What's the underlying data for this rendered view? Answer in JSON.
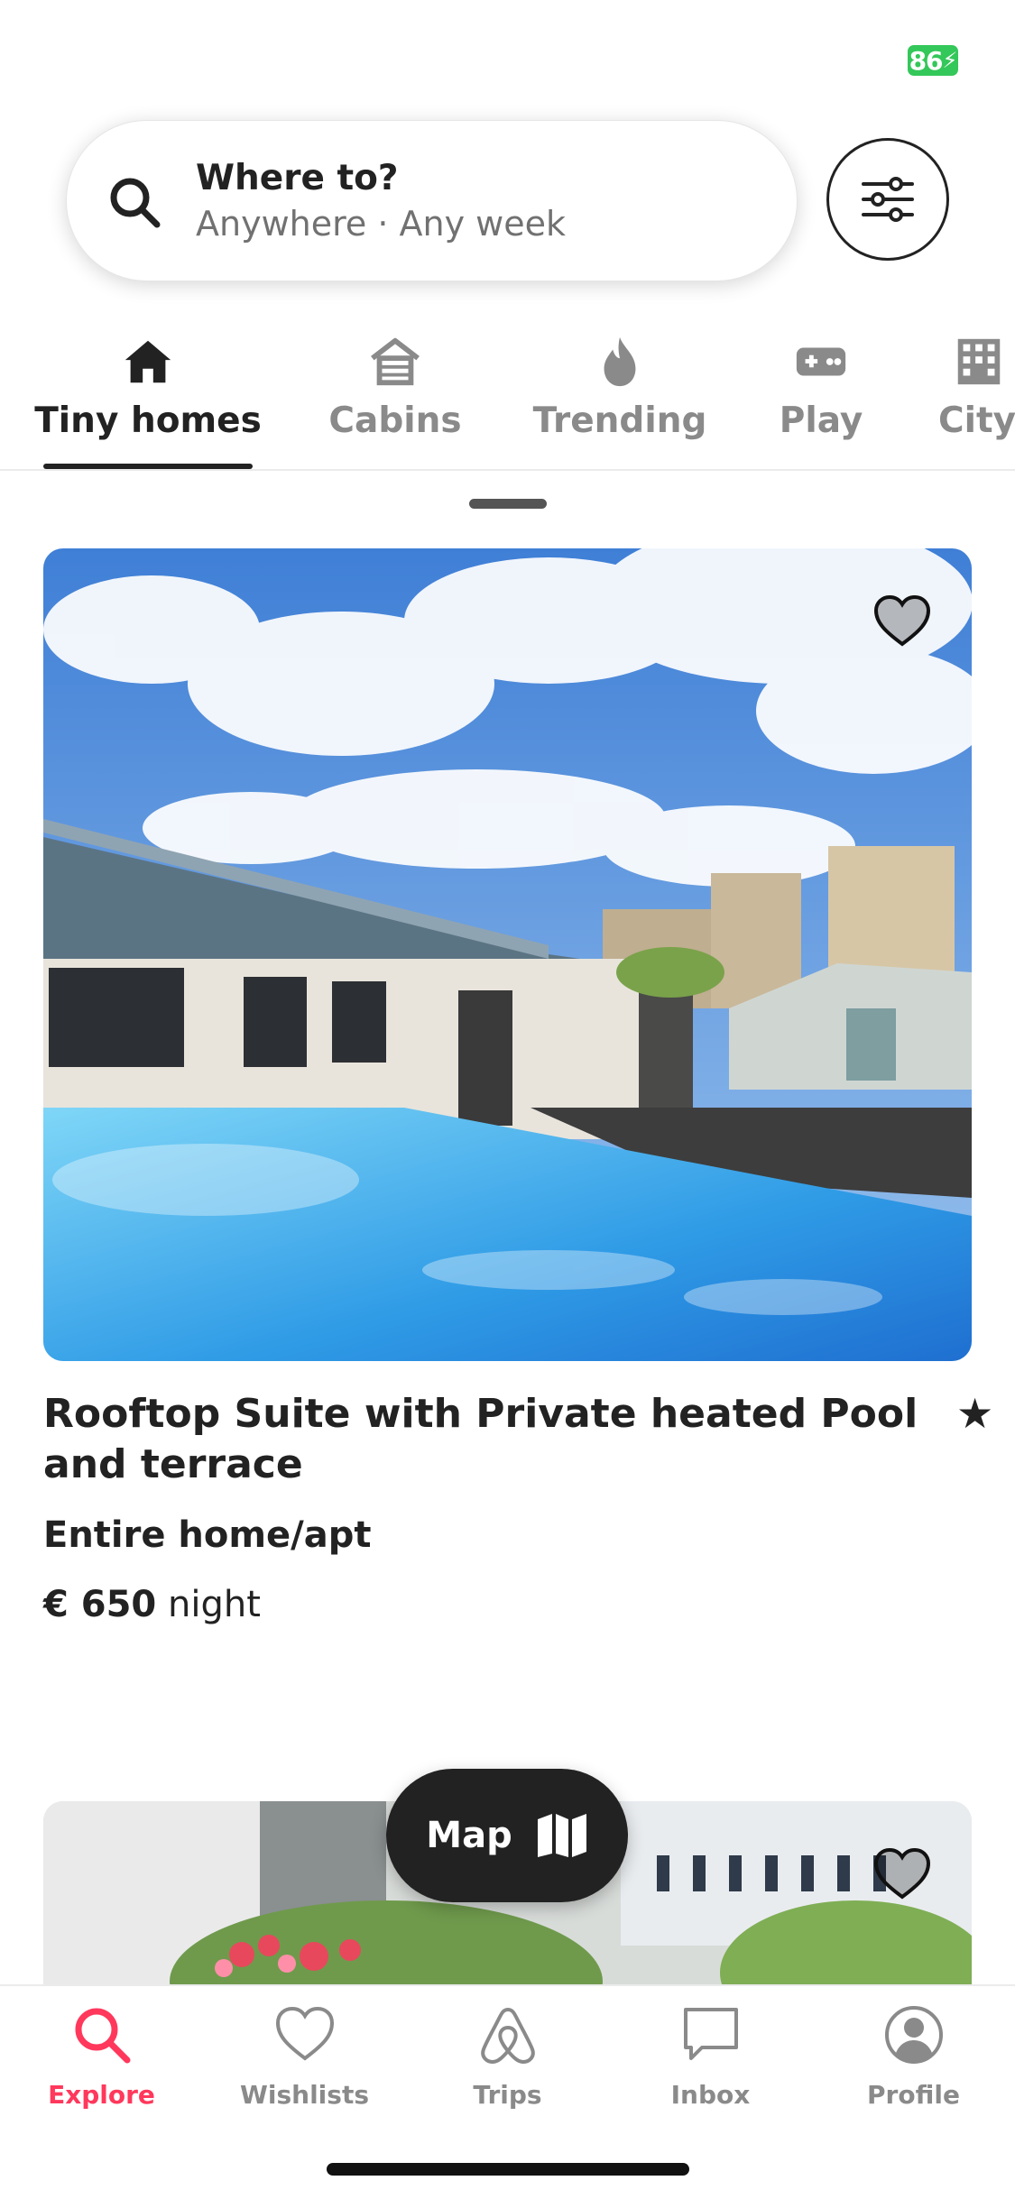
{
  "status_bar": {
    "battery": "86"
  },
  "search": {
    "title": "Where to?",
    "subtitle": "Anywhere · Any week"
  },
  "categories": [
    {
      "label": "Tiny homes",
      "icon": "home-icon",
      "active": true
    },
    {
      "label": "Cabins",
      "icon": "cabin-icon",
      "active": false
    },
    {
      "label": "Trending",
      "icon": "flame-icon",
      "active": false
    },
    {
      "label": "Play",
      "icon": "gamepad-icon",
      "active": false
    },
    {
      "label": "City",
      "icon": "building-icon",
      "active": false
    }
  ],
  "listings": [
    {
      "title": "Rooftop Suite with Private heated Pool and terrace",
      "rating_prefix": "★",
      "type": "Entire home/apt",
      "price": "€ 650",
      "price_unit": "night"
    }
  ],
  "map_button": {
    "label": "Map"
  },
  "tabbar": {
    "tabs": [
      {
        "label": "Explore",
        "icon": "search-icon",
        "active": true
      },
      {
        "label": "Wishlists",
        "icon": "heart-icon",
        "active": false
      },
      {
        "label": "Trips",
        "icon": "airbnb-logo-icon",
        "active": false
      },
      {
        "label": "Inbox",
        "icon": "message-icon",
        "active": false
      },
      {
        "label": "Profile",
        "icon": "user-circle-icon",
        "active": false
      }
    ]
  },
  "colors": {
    "accent": "#ff385c",
    "text": "#222222",
    "muted": "#717171",
    "battery": "#34c759"
  }
}
